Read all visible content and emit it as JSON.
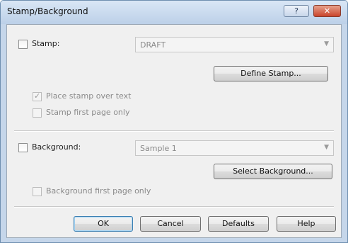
{
  "window": {
    "title": "Stamp/Background",
    "help_glyph": "?",
    "close_glyph": "✕"
  },
  "stamp": {
    "checkbox_label": "Stamp:",
    "checked": false,
    "combo_value": "DRAFT",
    "define_button": "Define Stamp...",
    "place_over_text_label": "Place stamp over text",
    "place_over_text_checked": true,
    "first_page_only_label": "Stamp first page only",
    "first_page_only_checked": false
  },
  "background": {
    "checkbox_label": "Background:",
    "checked": false,
    "combo_value": "Sample 1",
    "select_button": "Select Background...",
    "first_page_only_label": "Background first page only",
    "first_page_only_checked": false
  },
  "buttons": {
    "ok": "OK",
    "cancel": "Cancel",
    "defaults": "Defaults",
    "help": "Help"
  },
  "icons": {
    "help": "question-icon",
    "close": "close-icon",
    "combo_arrow": "chevron-down-icon",
    "check": "checkmark-icon"
  }
}
